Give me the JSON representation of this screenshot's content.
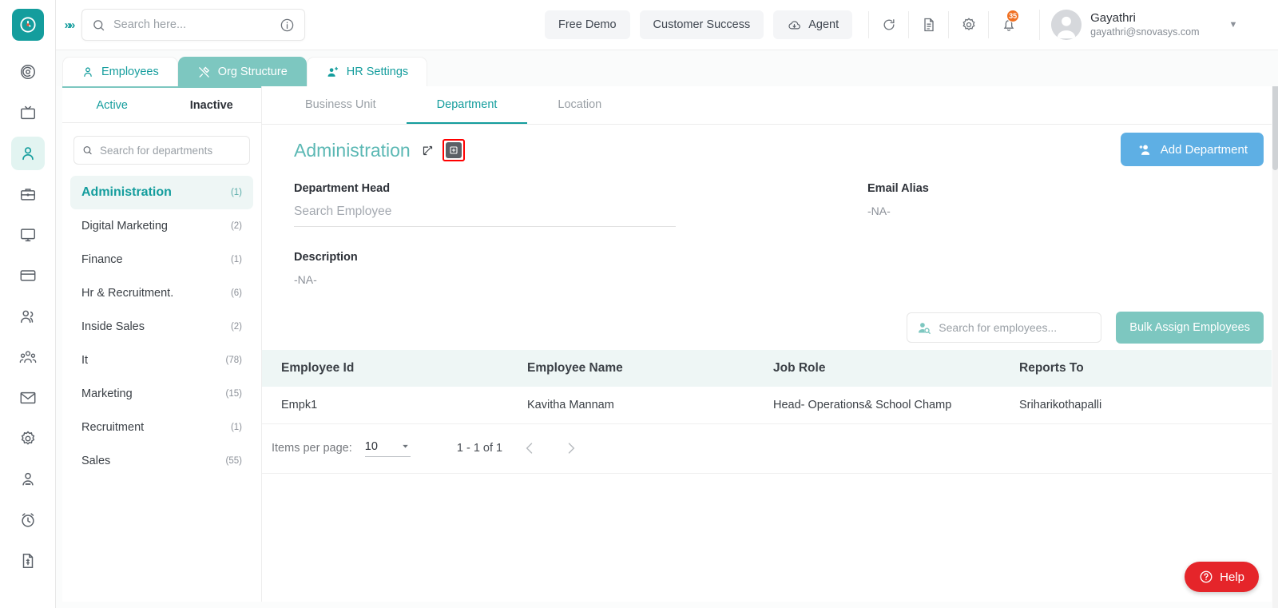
{
  "app": {
    "brand_color": "#149d9d",
    "accent_teal": "#7dc7c0",
    "accent_blue": "#5eafe4",
    "help_red": "#e5252a",
    "badge_orange": "#f07022"
  },
  "header": {
    "search_placeholder": "Search here...",
    "search_value": "",
    "pills": [
      {
        "label": "Free Demo",
        "icon": ""
      },
      {
        "label": "Customer Success",
        "icon": ""
      },
      {
        "label": "Agent",
        "icon": "cloud-download-icon"
      }
    ],
    "icons": [
      "refresh-icon",
      "document-icon",
      "gear-icon",
      "bell-icon"
    ],
    "notification_count": "35",
    "user": {
      "name": "Gayathri",
      "email": "gayathri@snovasys.com"
    }
  },
  "rail": {
    "items": [
      {
        "name": "dashboard-icon",
        "active": false
      },
      {
        "name": "tv-icon",
        "active": false
      },
      {
        "name": "person-icon",
        "active": true
      },
      {
        "name": "briefcase-icon",
        "active": false
      },
      {
        "name": "monitor-icon",
        "active": false
      },
      {
        "name": "card-icon",
        "active": false
      },
      {
        "name": "people-icon",
        "active": false
      },
      {
        "name": "team-icon",
        "active": false
      },
      {
        "name": "mail-icon",
        "active": false
      },
      {
        "name": "settings-icon",
        "active": false
      },
      {
        "name": "user-tie-icon",
        "active": false
      },
      {
        "name": "clock-icon",
        "active": false
      },
      {
        "name": "invoice-icon",
        "active": false
      }
    ]
  },
  "main_tabs": [
    {
      "label": "Employees",
      "icon": "person-icon",
      "active": false
    },
    {
      "label": "Org Structure",
      "icon": "tools-icon",
      "active": true
    },
    {
      "label": "HR Settings",
      "icon": "user-gear-icon",
      "active": false
    }
  ],
  "dept_panel": {
    "toggle": {
      "active_label": "Active",
      "inactive_label": "Inactive",
      "selected": "Active"
    },
    "search_placeholder": "Search for departments",
    "search_value": "",
    "departments": [
      {
        "name": "Administration",
        "count": "(1)",
        "selected": true
      },
      {
        "name": "Digital Marketing",
        "count": "(2)",
        "selected": false
      },
      {
        "name": "Finance",
        "count": "(1)",
        "selected": false
      },
      {
        "name": "Hr & Recruitment.",
        "count": "(6)",
        "selected": false
      },
      {
        "name": "Inside Sales",
        "count": "(2)",
        "selected": false
      },
      {
        "name": "It",
        "count": "(78)",
        "selected": false
      },
      {
        "name": "Marketing",
        "count": "(15)",
        "selected": false
      },
      {
        "name": "Recruitment",
        "count": "(1)",
        "selected": false
      },
      {
        "name": "Sales",
        "count": "(55)",
        "selected": false
      }
    ]
  },
  "sub_tabs": [
    {
      "label": "Business Unit",
      "active": false
    },
    {
      "label": "Department",
      "active": true
    },
    {
      "label": "Location",
      "active": false
    }
  ],
  "detail": {
    "title": "Administration",
    "edit_icon": "edit-icon",
    "archive_icon": "archive-icon",
    "add_button": "Add Department",
    "add_button_icon": "add-person-icon",
    "dept_head_label": "Department Head",
    "dept_head_placeholder": "Search Employee",
    "dept_head_value": "",
    "description_label": "Description",
    "description_value": "-NA-",
    "email_alias_label": "Email Alias",
    "email_alias_value": "-NA-"
  },
  "assign": {
    "search_placeholder": "Search for employees...",
    "search_value": "",
    "search_icon": "person-search-icon",
    "bulk_button": "Bulk Assign Employees"
  },
  "table": {
    "columns": [
      "Employee Id",
      "Employee Name",
      "Job Role",
      "Reports To"
    ],
    "rows": [
      {
        "employee_id": "Empk1",
        "employee_name": "Kavitha Mannam",
        "job_role": "Head- Operations& School Champ",
        "reports_to": "Sriharikothapalli"
      }
    ]
  },
  "pager": {
    "items_per_page_label": "Items per page:",
    "items_per_page_value": "10",
    "range": "1 - 1 of 1",
    "prev_icon": "chevron-left-icon",
    "next_icon": "chevron-right-icon"
  },
  "help": {
    "label": "Help",
    "icon": "question-circle-icon"
  }
}
